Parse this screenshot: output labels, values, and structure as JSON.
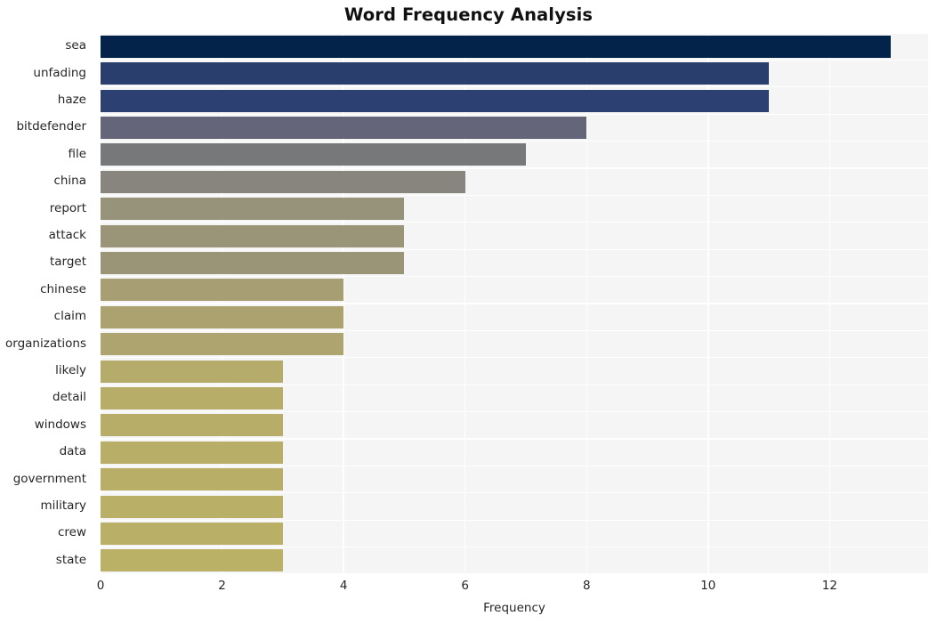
{
  "chart_data": {
    "type": "bar",
    "orientation": "horizontal",
    "title": "Word Frequency Analysis",
    "xlabel": "Frequency",
    "ylabel": "",
    "xlim": [
      0,
      13.62
    ],
    "xticks": [
      0,
      2,
      4,
      6,
      8,
      10,
      12
    ],
    "xtick_labels": [
      "0",
      "2",
      "4",
      "6",
      "8",
      "10",
      "12"
    ],
    "grid": true,
    "legend": null,
    "categories": [
      "sea",
      "unfading",
      "haze",
      "bitdefender",
      "file",
      "china",
      "report",
      "attack",
      "target",
      "chinese",
      "claim",
      "organizations",
      "likely",
      "detail",
      "windows",
      "data",
      "government",
      "military",
      "crew",
      "state"
    ],
    "values": [
      13,
      11,
      11,
      8,
      7,
      6,
      5,
      5,
      5,
      4,
      4,
      4,
      3,
      3,
      3,
      3,
      3,
      3,
      3,
      3
    ],
    "bar_colors": [
      "#04234b",
      "#2a3e6e",
      "#2c4072",
      "#646579",
      "#76787a",
      "#87857d",
      "#97927a",
      "#9a9479",
      "#9b9578",
      "#a79f73",
      "#ab a26f",
      "#ada470",
      "#b5ab6a",
      "#b7ad69",
      "#b8ad68",
      "#b8ae68",
      "#b9ae67",
      "#b9af67",
      "#baaf66",
      "#bab066"
    ],
    "plot_background": "#f5f5f5",
    "grid_color": "#ffffff",
    "title_color": "#111111",
    "tick_color": "#262626"
  }
}
